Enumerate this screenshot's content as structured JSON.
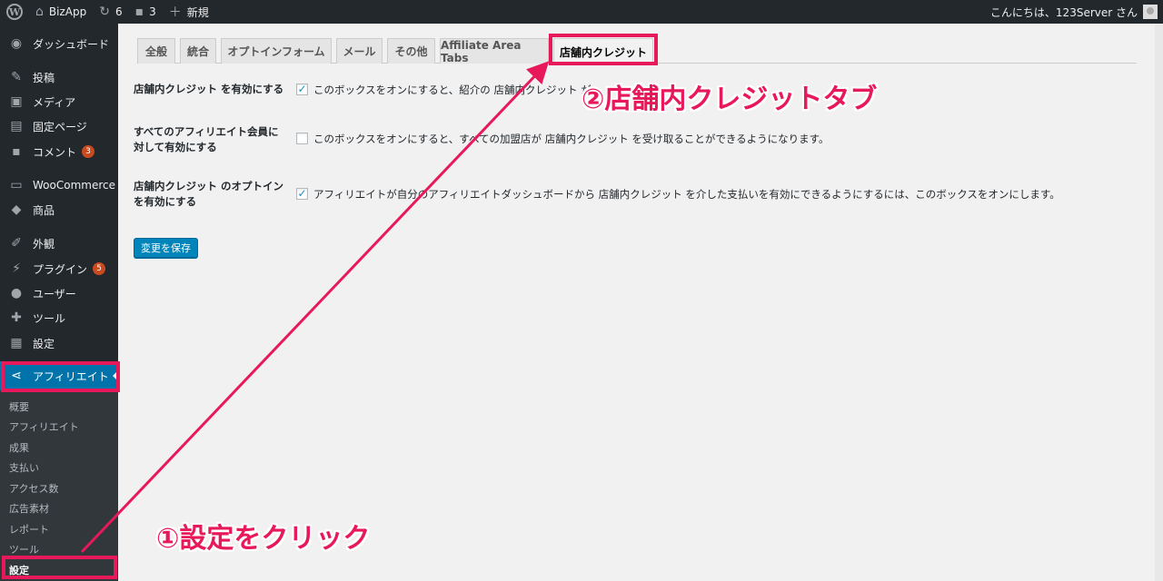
{
  "adminbar": {
    "logo_glyph": "W",
    "site_name": "BizApp",
    "updates_count": "6",
    "comments_count": "3",
    "new_label": "新規",
    "greeting": "こんにちは、123Server さん"
  },
  "sidebar": {
    "items": [
      {
        "label": "ダッシュボード",
        "icon": "dashboard-icon"
      },
      {
        "label": "投稿",
        "icon": "pin-icon"
      },
      {
        "label": "メディア",
        "icon": "media-icon"
      },
      {
        "label": "固定ページ",
        "icon": "page-icon"
      },
      {
        "label": "コメント",
        "icon": "comment-icon",
        "badge": "3"
      },
      {
        "label": "WooCommerce",
        "icon": "woo-icon"
      },
      {
        "label": "商品",
        "icon": "box-icon"
      },
      {
        "label": "外観",
        "icon": "brush-icon"
      },
      {
        "label": "プラグイン",
        "icon": "plugin-icon",
        "badge": "5"
      },
      {
        "label": "ユーザー",
        "icon": "user-icon"
      },
      {
        "label": "ツール",
        "icon": "wrench-icon"
      },
      {
        "label": "設定",
        "icon": "settings-icon"
      },
      {
        "label": "アフィリエイト",
        "icon": "share-icon"
      }
    ],
    "submenu": [
      "概要",
      "アフィリエイト",
      "成果",
      "支払い",
      "アクセス数",
      "広告素材",
      "レポート",
      "ツール",
      "設定"
    ]
  },
  "tabs": [
    "全般",
    "統合",
    "オプトインフォーム",
    "メール",
    "その他",
    "Affiliate Area Tabs",
    "店舗内クレジット"
  ],
  "rows": [
    {
      "label": "店舗内クレジット を有効にする",
      "checked": true,
      "desc": "このボックスをオンにすると、紹介の 店舗内クレジット が"
    },
    {
      "label": "すべてのアフィリエイト会員に対して有効にする",
      "checked": false,
      "desc": "このボックスをオンにすると、すべての加盟店が 店舗内クレジット を受け取ることができるようになります。"
    },
    {
      "label": "店舗内クレジット のオプトインを有効にする",
      "checked": true,
      "desc": "アフィリエイトが自分のアフィリエイトダッシュボードから 店舗内クレジット を介した支払いを有効にできるようにするには、このボックスをオンにします。"
    }
  ],
  "save_button": "変更を保存",
  "annotations": {
    "step1": "①設定をクリック",
    "step2": "②店舗内クレジットタブ",
    "color": "#e8195a"
  },
  "colors": {
    "adminbar": "#23282d",
    "active_menu": "#0073aa",
    "primary_button": "#0085ba"
  }
}
